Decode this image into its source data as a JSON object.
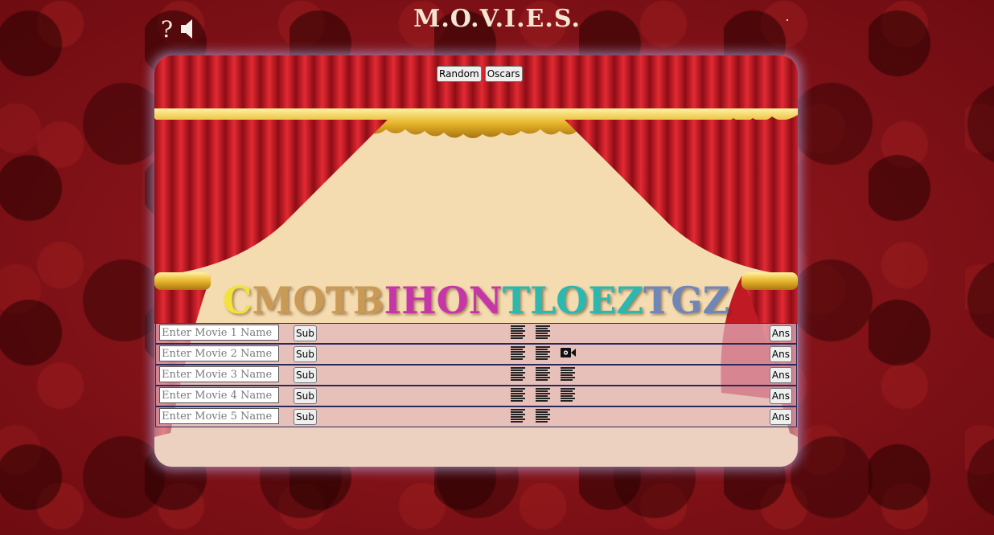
{
  "header": {
    "title": "M.O.V.I.E.S.",
    "help_label": "?",
    "sound_icon": "speaker-icon"
  },
  "toolbar": {
    "random_label": "Random",
    "oscars_label": "Oscars"
  },
  "puzzle": {
    "letters": [
      {
        "ch": "C",
        "color": "#f2e23a"
      },
      {
        "ch": "M",
        "color": "#c99a55"
      },
      {
        "ch": "O",
        "color": "#c99a55"
      },
      {
        "ch": "T",
        "color": "#c99a55"
      },
      {
        "ch": "B",
        "color": "#c99a55"
      },
      {
        "ch": "I",
        "color": "#c636a8"
      },
      {
        "ch": "H",
        "color": "#c636a8"
      },
      {
        "ch": "O",
        "color": "#c636a8"
      },
      {
        "ch": "N",
        "color": "#c636a8"
      },
      {
        "ch": "T",
        "color": "#2ab8b0"
      },
      {
        "ch": "L",
        "color": "#2ab8b0"
      },
      {
        "ch": "O",
        "color": "#2ab8b0"
      },
      {
        "ch": "E",
        "color": "#2ab8b0"
      },
      {
        "ch": "Z",
        "color": "#2ab8b0"
      },
      {
        "ch": "T",
        "color": "#6f86b8"
      },
      {
        "ch": "G",
        "color": "#6f86b8"
      },
      {
        "ch": "Z",
        "color": "#6f86b8"
      }
    ]
  },
  "rows": [
    {
      "placeholder": "Enter Movie 1 Name",
      "sub_label": "Sub",
      "ans_label": "Ans",
      "hints": [
        "text-hint-icon",
        "text-hint-icon"
      ]
    },
    {
      "placeholder": "Enter Movie 2 Name",
      "sub_label": "Sub",
      "ans_label": "Ans",
      "hints": [
        "text-hint-icon",
        "text-hint-icon",
        "video-camera-icon"
      ]
    },
    {
      "placeholder": "Enter Movie 3 Name",
      "sub_label": "Sub",
      "ans_label": "Ans",
      "hints": [
        "text-hint-icon",
        "text-hint-icon",
        "text-hint-icon"
      ]
    },
    {
      "placeholder": "Enter Movie 4 Name",
      "sub_label": "Sub",
      "ans_label": "Ans",
      "hints": [
        "text-hint-icon",
        "text-hint-icon",
        "text-hint-icon"
      ]
    },
    {
      "placeholder": "Enter Movie 5 Name",
      "sub_label": "Sub",
      "ans_label": "Ans",
      "hints": [
        "text-hint-icon",
        "text-hint-icon"
      ]
    }
  ]
}
